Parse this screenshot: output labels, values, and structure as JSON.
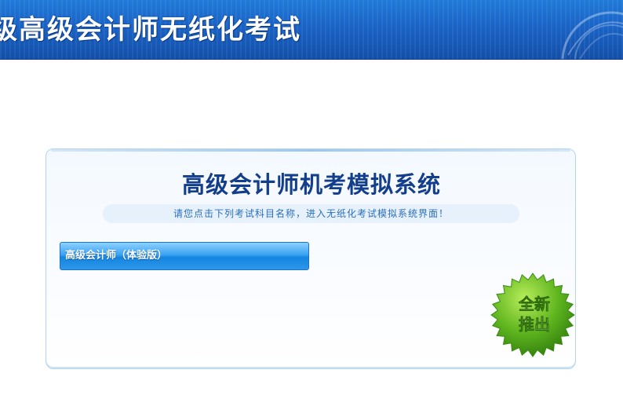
{
  "banner": {
    "title": "级高级会计师无纸化考试"
  },
  "panel": {
    "title": "高级会计师机考模拟系统",
    "hint": "请您点击下列考试科目名称，进入无纸化考试模拟系统界面！",
    "exam_button_label": "高级会计师（体验版）",
    "badge": {
      "line1": "全新",
      "line2": "推出"
    }
  },
  "colors": {
    "banner_blue": "#1a63c6",
    "title_navy": "#123e8c",
    "hint_text": "#2b6fbd",
    "button_blue": "#1486e0",
    "badge_green": "#4aa51a"
  }
}
